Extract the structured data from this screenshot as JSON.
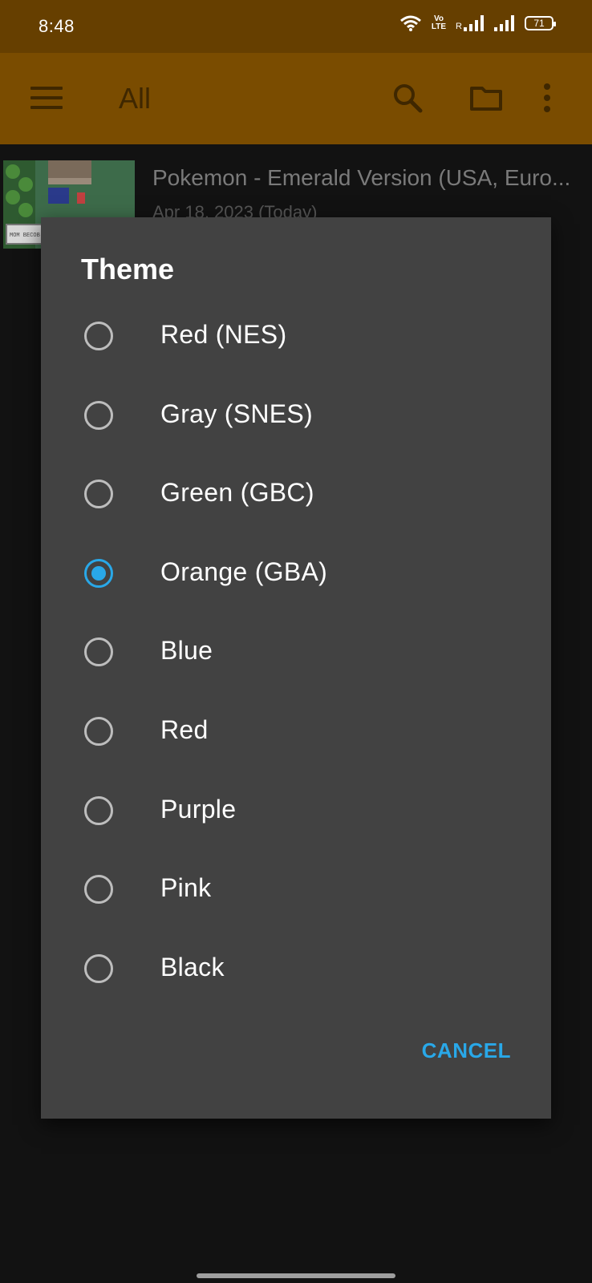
{
  "status_bar": {
    "time": "8:48",
    "volte_top": "Vo",
    "volte_bottom": "LTE",
    "roaming": "R",
    "battery": "71"
  },
  "app_bar": {
    "title": "All",
    "icons": [
      "menu-icon",
      "search-icon",
      "folder-icon",
      "more-vert-icon"
    ]
  },
  "list": {
    "items": [
      {
        "title": "Pokemon - Emerald Version (USA, Euro...",
        "subtitle": "Apr 18, 2023 (Today)",
        "thumb_text": "MOM BECOB"
      }
    ]
  },
  "dialog": {
    "title": "Theme",
    "options": [
      {
        "label": "Red (NES)",
        "selected": false
      },
      {
        "label": "Gray (SNES)",
        "selected": false
      },
      {
        "label": "Green (GBC)",
        "selected": false
      },
      {
        "label": "Orange (GBA)",
        "selected": true
      },
      {
        "label": "Blue",
        "selected": false
      },
      {
        "label": "Red",
        "selected": false
      },
      {
        "label": "Purple",
        "selected": false
      },
      {
        "label": "Pink",
        "selected": false
      },
      {
        "label": "Black",
        "selected": false
      }
    ],
    "cancel_label": "CANCEL"
  },
  "colors": {
    "accent": "#29a8e8",
    "dialog_bg": "#424242",
    "app_bar": "#7a4c00",
    "status_bar": "#663f00"
  }
}
